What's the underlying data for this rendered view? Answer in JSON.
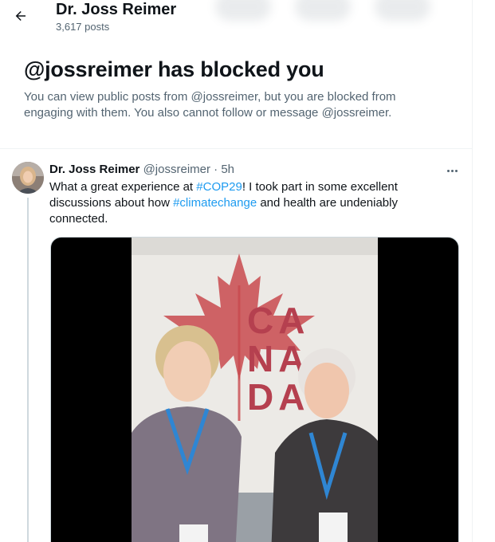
{
  "header": {
    "title": "Dr. Joss Reimer",
    "posts_count": "3,617 posts"
  },
  "blocked": {
    "title": "@jossreimer has blocked you",
    "description": "You can view public posts from @jossreimer, but you are blocked from engaging with them. You also cannot follow or message @jossreimer."
  },
  "post": {
    "author_name": "Dr. Joss Reimer",
    "author_handle": "@jossreimer",
    "separator": " · ",
    "time": "5h",
    "text_1": "What a great experience at ",
    "hashtag_1": "#COP29",
    "text_2": "! I took part in some excellent discussions about how ",
    "hashtag_2": "#climatechange",
    "text_3": " and health are undeniably connected."
  },
  "photo": {
    "sign_line_1": "CA",
    "sign_line_2": "NA",
    "sign_line_3": "DA"
  },
  "colors": {
    "link": "#1d9bf0",
    "text": "#0f1419",
    "secondary": "#536471",
    "sign_red": "#b5404f"
  },
  "icons": {
    "back": "arrow-left-icon",
    "more": "more-horizontal-icon"
  }
}
